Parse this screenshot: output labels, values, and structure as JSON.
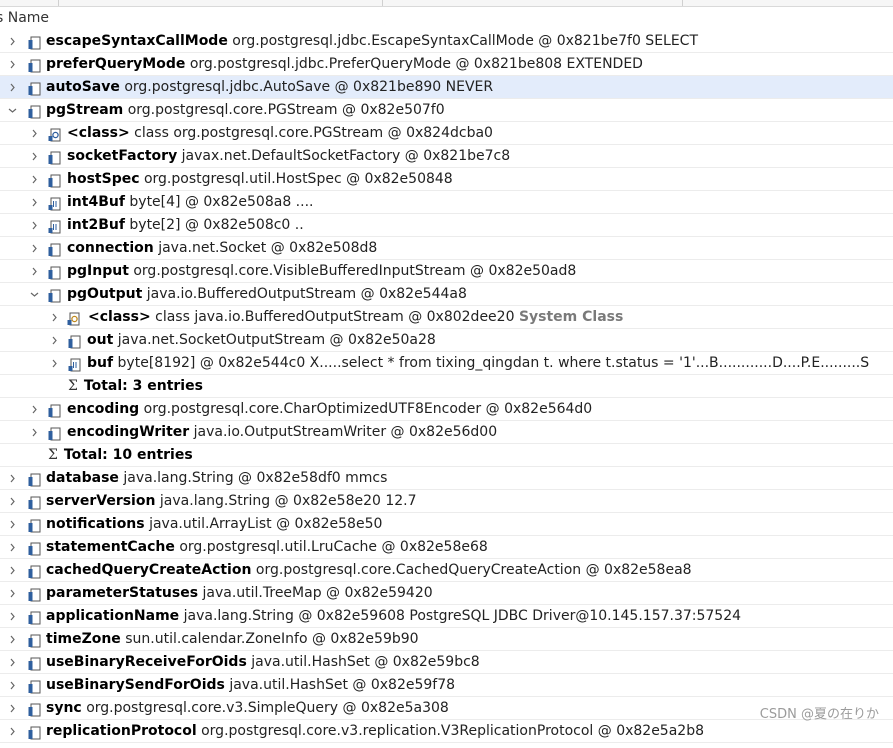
{
  "header": {
    "column_label": "s Name"
  },
  "rows": [
    {
      "name": "escapeSyntaxCallMode",
      "value": "org.postgresql.jdbc.EscapeSyntaxCallMode @ 0x821be7f0  SELECT"
    },
    {
      "name": "preferQueryMode",
      "value": "org.postgresql.jdbc.PreferQueryMode @ 0x821be808  EXTENDED"
    },
    {
      "name": "autoSave",
      "value": "org.postgresql.jdbc.AutoSave @ 0x821be890  NEVER"
    },
    {
      "name": "pgStream",
      "value": "org.postgresql.core.PGStream @ 0x82e507f0"
    },
    {
      "name": "<class>",
      "value": "class org.postgresql.core.PGStream @ 0x824dcba0"
    },
    {
      "name": "socketFactory",
      "value": "javax.net.DefaultSocketFactory @ 0x821be7c8"
    },
    {
      "name": "hostSpec",
      "value": "org.postgresql.util.HostSpec @ 0x82e50848"
    },
    {
      "name": "int4Buf",
      "value": "byte[4] @ 0x82e508a8  ...."
    },
    {
      "name": "int2Buf",
      "value": "byte[2] @ 0x82e508c0  .."
    },
    {
      "name": "connection",
      "value": "java.net.Socket @ 0x82e508d8"
    },
    {
      "name": "pgInput",
      "value": "org.postgresql.core.VisibleBufferedInputStream @ 0x82e50ad8"
    },
    {
      "name": "pgOutput",
      "value": "java.io.BufferedOutputStream @ 0x82e544a8"
    },
    {
      "name": "<class>",
      "value": "class java.io.BufferedOutputStream @ 0x802dee20",
      "extra": "System Class"
    },
    {
      "name": "out",
      "value": "java.net.SocketOutputStream @ 0x82e50a28"
    },
    {
      "name": "buf",
      "value": "byte[8192] @ 0x82e544c0  X.....select * from tixing_qingdan t.        where t.status = '1'...B............D....P.E.........S"
    },
    {
      "total": "Total: 3 entries"
    },
    {
      "name": "encoding",
      "value": "org.postgresql.core.CharOptimizedUTF8Encoder @ 0x82e564d0"
    },
    {
      "name": "encodingWriter",
      "value": "java.io.OutputStreamWriter @ 0x82e56d00"
    },
    {
      "total": "Total: 10 entries"
    },
    {
      "name": "database",
      "value": "java.lang.String @ 0x82e58df0  mmcs"
    },
    {
      "name": "serverVersion",
      "value": "java.lang.String @ 0x82e58e20  12.7"
    },
    {
      "name": "notifications",
      "value": "java.util.ArrayList @ 0x82e58e50"
    },
    {
      "name": "statementCache",
      "value": "org.postgresql.util.LruCache @ 0x82e58e68"
    },
    {
      "name": "cachedQueryCreateAction",
      "value": "org.postgresql.core.CachedQueryCreateAction @ 0x82e58ea8"
    },
    {
      "name": "parameterStatuses",
      "value": "java.util.TreeMap @ 0x82e59420"
    },
    {
      "name": "applicationName",
      "value": "java.lang.String @ 0x82e59608  PostgreSQL JDBC Driver@10.145.157.37:57524"
    },
    {
      "name": "timeZone",
      "value": "sun.util.calendar.ZoneInfo @ 0x82e59b90"
    },
    {
      "name": "useBinaryReceiveForOids",
      "value": "java.util.HashSet @ 0x82e59bc8"
    },
    {
      "name": "useBinarySendForOids",
      "value": "java.util.HashSet @ 0x82e59f78"
    },
    {
      "name": "sync",
      "value": "org.postgresql.core.v3.SimpleQuery @ 0x82e5a308"
    },
    {
      "name": "replicationProtocol",
      "value": "org.postgresql.core.v3.replication.V3ReplicationProtocol @ 0x82e5a2b8"
    }
  ],
  "watermark": "CSDN @夏の在りか",
  "colors": {
    "selected_row": "#e3ecfb",
    "system_class": "#7a7a7a",
    "icon_blue": "#2f5f9e"
  }
}
